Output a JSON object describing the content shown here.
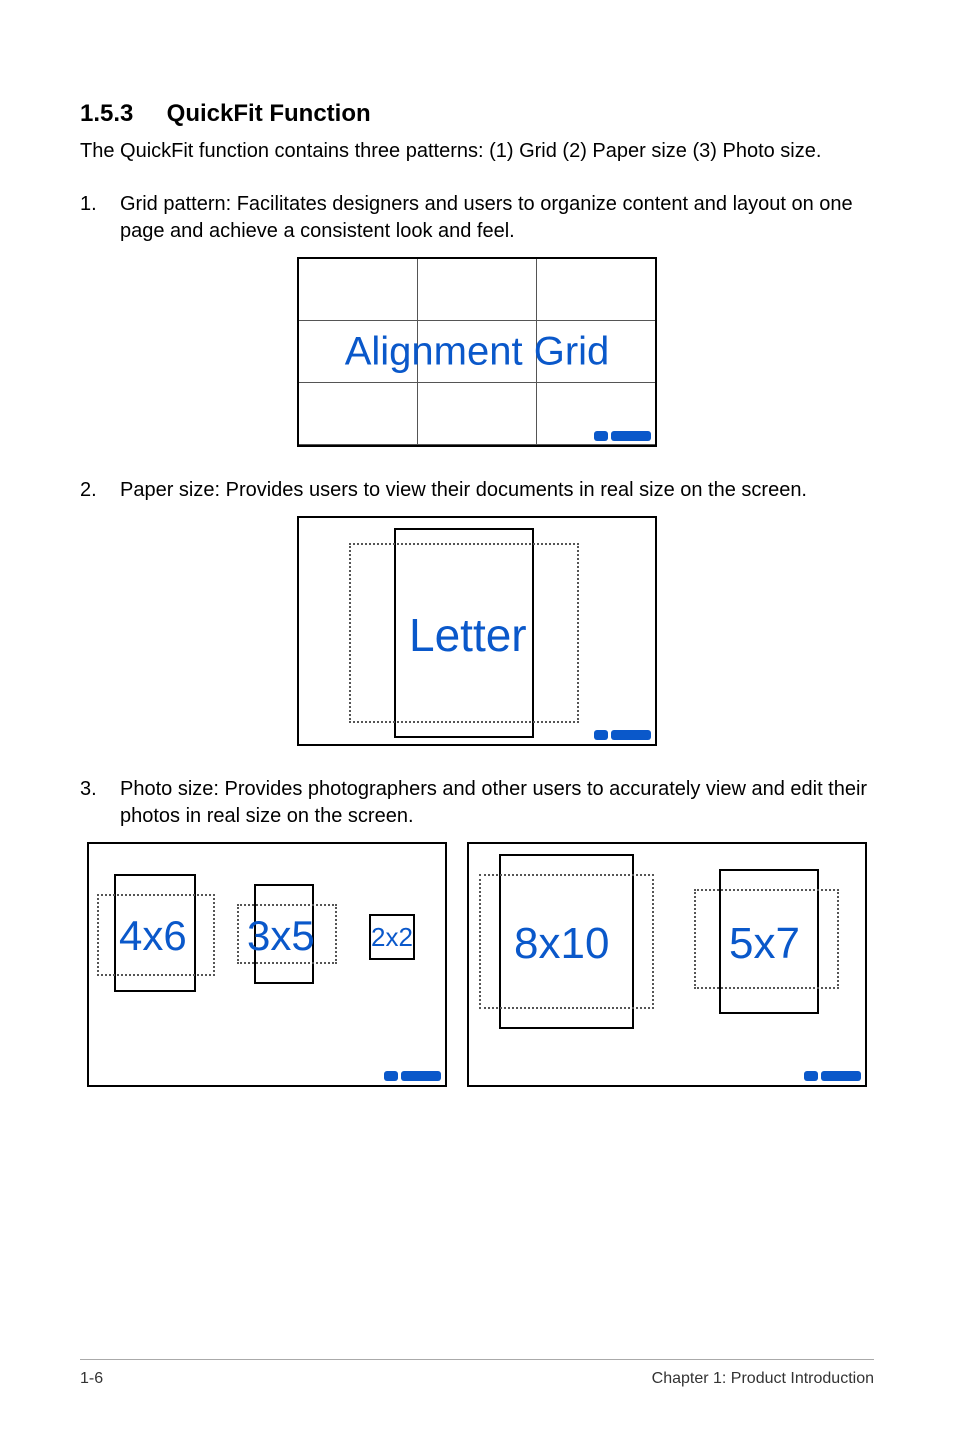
{
  "heading": {
    "number": "1.5.3",
    "title": "QuickFit Function"
  },
  "intro": "The QuickFit function contains three patterns: (1) Grid (2) Paper size (3) Photo size.",
  "items": [
    {
      "num": "1.",
      "text": "Grid pattern: Facilitates designers and users to organize content and layout on one page and achieve a consistent look and feel."
    },
    {
      "num": "2.",
      "text": "Paper size: Provides users to view their documents in real size on the screen."
    },
    {
      "num": "3.",
      "text": "Photo size: Provides photographers and other users to accurately view and edit their photos in real size on the screen."
    }
  ],
  "fig1_label": "Alignment Grid",
  "fig2_label": "Letter",
  "photo_labels": {
    "p1": "4x6",
    "p2": "3x5",
    "p3": "2x2",
    "p4": "8x10",
    "p5": "5x7"
  },
  "footer": {
    "left": "1-6",
    "right": "Chapter 1: Product Introduction"
  }
}
